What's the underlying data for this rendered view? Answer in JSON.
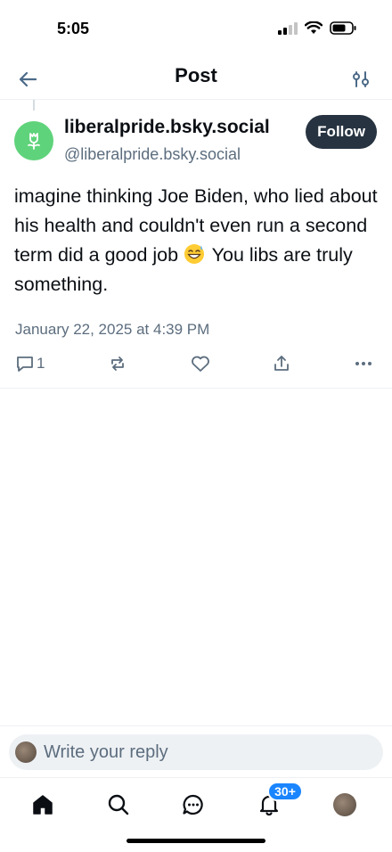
{
  "status_bar": {
    "time": "5:05"
  },
  "header": {
    "title": "Post"
  },
  "post": {
    "display_name": "liberalpride.bsky.social",
    "handle": "@liberalpride.bsky.social",
    "follow_label": "Follow",
    "text_before_emoji": "imagine thinking Joe Biden, who lied about his health and couldn't even run a second term did a good job",
    "text_after_emoji": "You libs are truly something.",
    "emoji": "grinning-face-with-sweat",
    "date": "January 22, 2025 at 4:39 PM",
    "reply_count": "1",
    "avatar_color": "#5fd37b"
  },
  "composer": {
    "placeholder": "Write your reply"
  },
  "tabbar": {
    "notifications_badge": "30+"
  },
  "colors": {
    "accent": "#1a85ff",
    "muted_text": "#5c6d7e",
    "follow_button_bg": "#273340"
  },
  "icons": [
    "back-arrow-icon",
    "filter-sliders-icon",
    "flower-icon",
    "reply-icon",
    "repost-icon",
    "like-icon",
    "share-icon",
    "more-icon",
    "home-icon",
    "search-icon",
    "chat-icon",
    "bell-icon"
  ]
}
